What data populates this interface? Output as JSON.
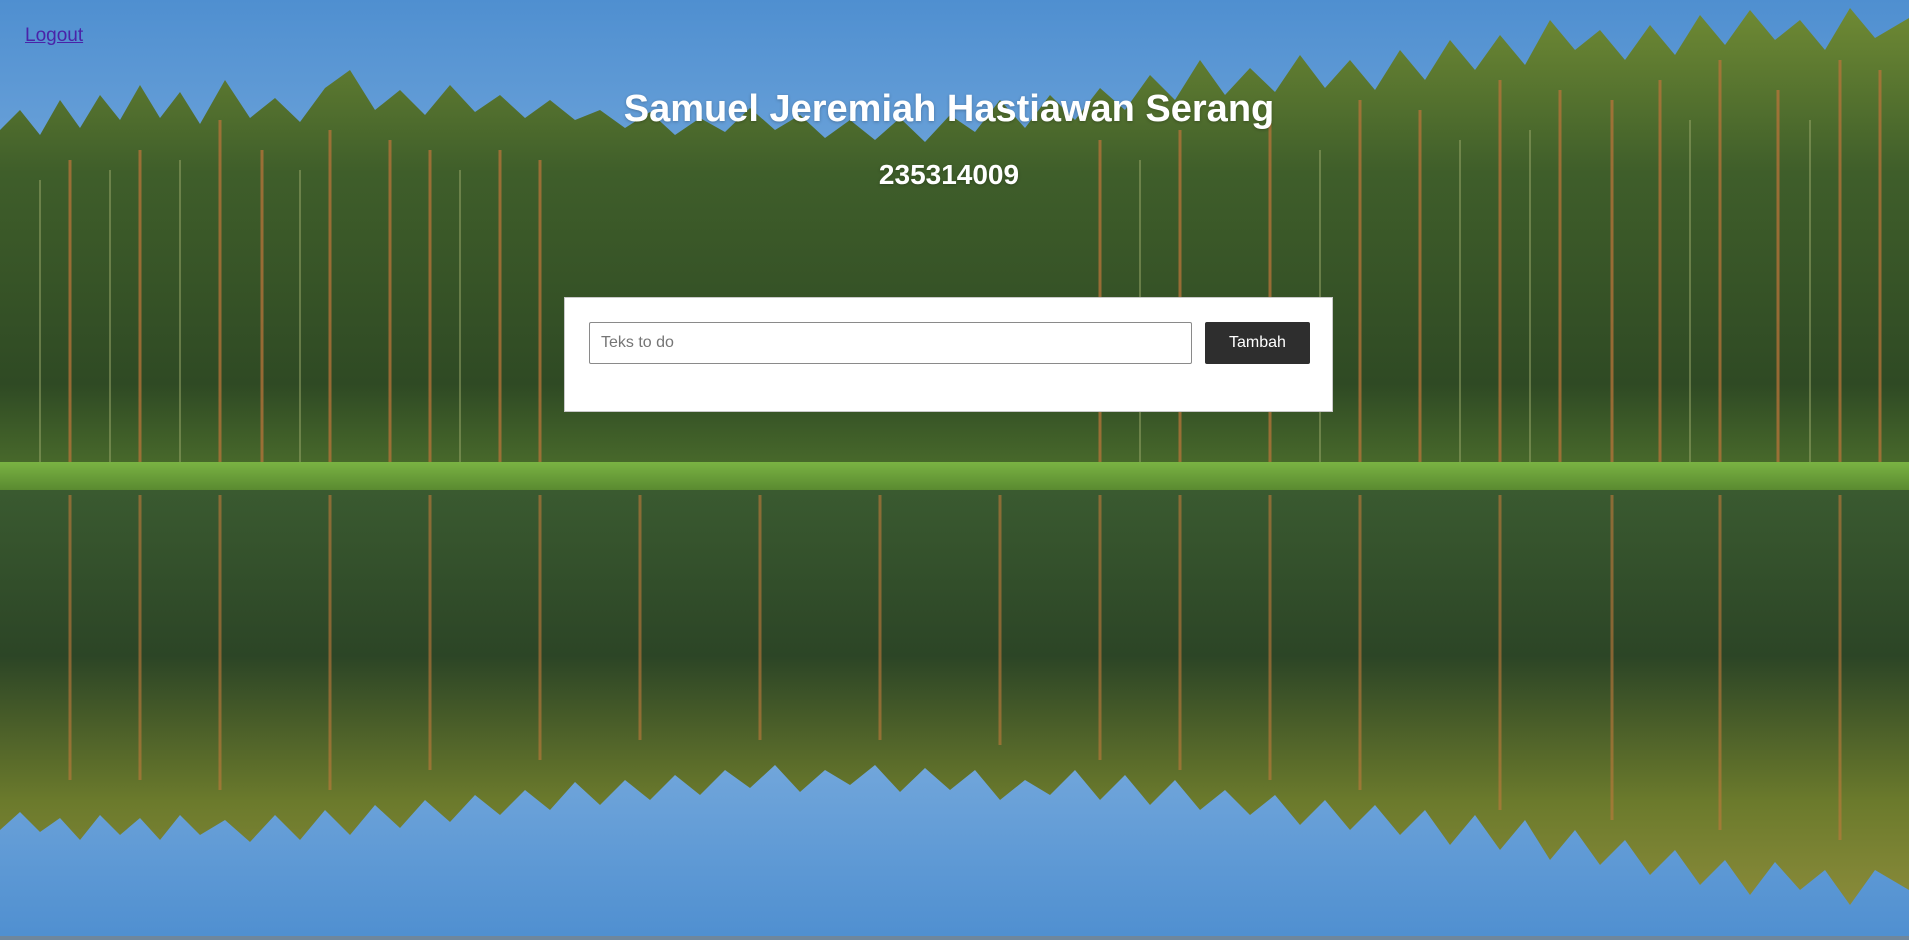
{
  "nav": {
    "logout_label": "Logout"
  },
  "header": {
    "name": "Samuel Jeremiah Hastiawan Serang",
    "student_id": "235314009"
  },
  "todo_form": {
    "input_placeholder": "Teks to do",
    "input_value": "",
    "add_button_label": "Tambah"
  },
  "background": {
    "scene": "forest-lake-reflection"
  },
  "colors": {
    "sky": "#5b95cf",
    "forest_dark": "#2f4a24",
    "forest_light": "#5e7d30",
    "grass": "#6aa33a",
    "button_bg": "#2e2e2e",
    "link": "#4a23a8",
    "heading": "#ffffff"
  }
}
